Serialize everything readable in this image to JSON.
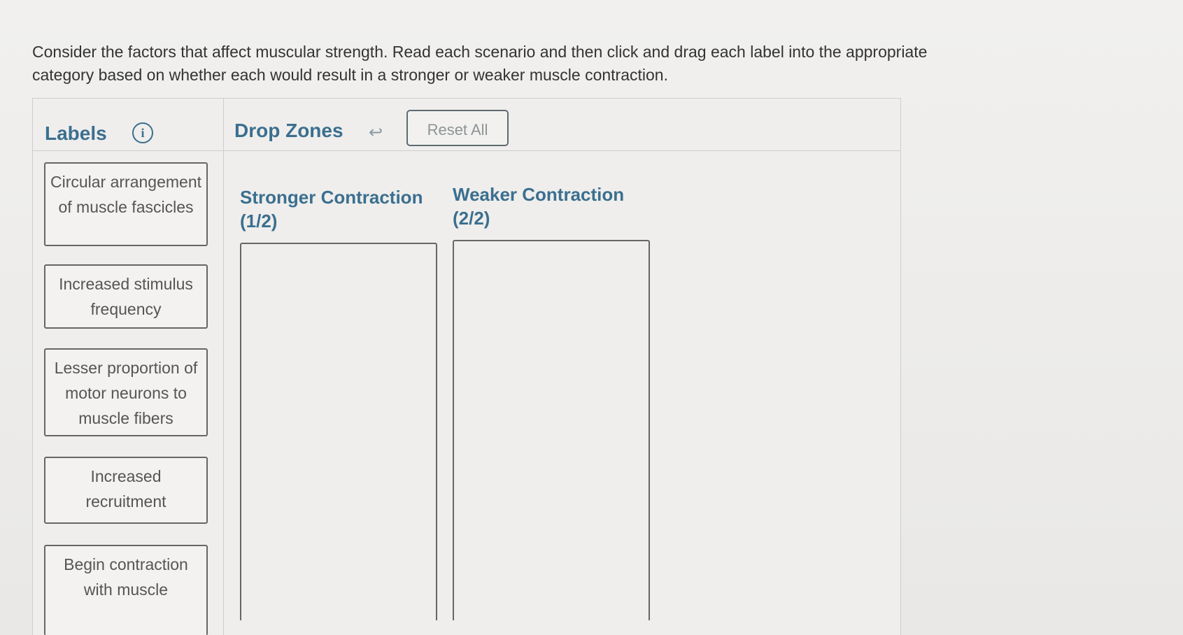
{
  "instructions": "Consider the factors that affect muscular strength. Read each scenario and then click and drag each label into the appropriate category based on whether each would result in a stronger or weaker muscle contraction.",
  "labels_header": {
    "title": "Labels",
    "info_icon": "info-icon",
    "info_glyph": "i"
  },
  "dropzones_header": {
    "title": "Drop Zones",
    "undo_icon": "undo-icon",
    "undo_glyph": "↩",
    "reset_label": "Reset All"
  },
  "labels": [
    {
      "text": "Circular arrangement of muscle fascicles"
    },
    {
      "text": "Increased stimulus frequency"
    },
    {
      "text": "Lesser proportion of motor neurons to muscle fibers"
    },
    {
      "text": "Increased recruitment"
    },
    {
      "text": "Begin contraction with muscle"
    }
  ],
  "zones": [
    {
      "title": "Stronger Contraction",
      "count": "(1/2)"
    },
    {
      "title": "Weaker Contraction",
      "count": "(2/2)"
    }
  ],
  "colors": {
    "accent": "#3b6f8f",
    "border": "#666666",
    "background": "#efeeec"
  }
}
